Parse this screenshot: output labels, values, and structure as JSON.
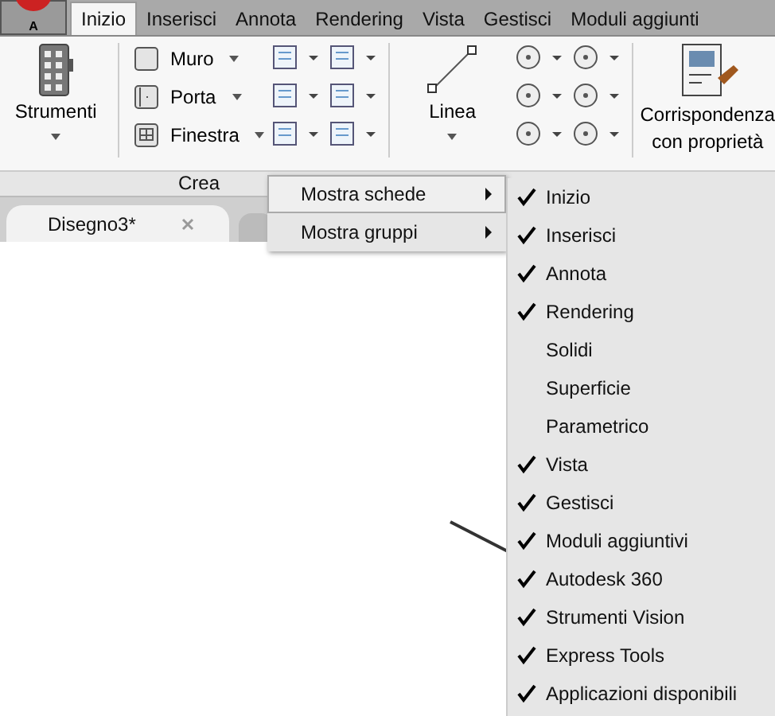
{
  "app_button": {
    "label": "A"
  },
  "tabs": [
    {
      "label": "Inizio",
      "selected": true
    },
    {
      "label": "Inserisci",
      "selected": false
    },
    {
      "label": "Annota",
      "selected": false
    },
    {
      "label": "Rendering",
      "selected": false
    },
    {
      "label": "Vista",
      "selected": false
    },
    {
      "label": "Gestisci",
      "selected": false
    },
    {
      "label": "Moduli aggiunti",
      "selected": false
    }
  ],
  "ribbon": {
    "strumenti": "Strumenti",
    "small_tools": [
      "Muro",
      "Porta",
      "Finestra"
    ],
    "linea": "Linea",
    "corrispondenza": [
      "Corrispondenza",
      "con proprietà"
    ],
    "panel_title": "Crea"
  },
  "document_tab": {
    "title": "Disegno3*"
  },
  "context_menu": [
    {
      "label": "Mostra schede",
      "selected": true
    },
    {
      "label": "Mostra gruppi",
      "selected": false
    }
  ],
  "submenu": [
    {
      "label": "Inizio",
      "checked": true
    },
    {
      "label": "Inserisci",
      "checked": true
    },
    {
      "label": "Annota",
      "checked": true
    },
    {
      "label": "Rendering",
      "checked": true
    },
    {
      "label": "Solidi",
      "checked": false
    },
    {
      "label": "Superficie",
      "checked": false
    },
    {
      "label": "Parametrico",
      "checked": false
    },
    {
      "label": "Vista",
      "checked": true
    },
    {
      "label": "Gestisci",
      "checked": true
    },
    {
      "label": "Moduli aggiuntivi",
      "checked": true
    },
    {
      "label": "Autodesk 360",
      "checked": true
    },
    {
      "label": "Strumenti Vision",
      "checked": true
    },
    {
      "label": "Express Tools",
      "checked": true
    },
    {
      "label": "Applicazioni disponibili",
      "checked": true
    }
  ]
}
